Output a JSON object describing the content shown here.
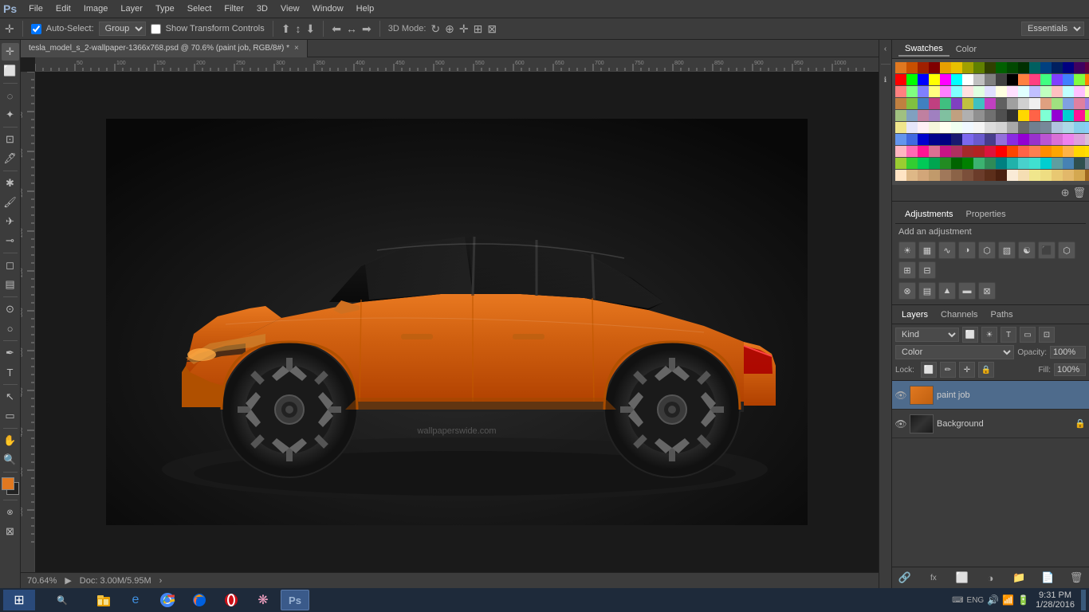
{
  "app": {
    "logo": "Ps",
    "title": "tesla_model_s_2-wallpaper-1366x768.psd @ 70.6% (paint job, RGB/8#) *"
  },
  "menubar": {
    "items": [
      "File",
      "Edit",
      "Image",
      "Layer",
      "Type",
      "Select",
      "Filter",
      "3D",
      "View",
      "Window",
      "Help"
    ]
  },
  "options_bar": {
    "auto_select_label": "Auto-Select:",
    "auto_select_type": "Group",
    "show_transform": "Show Transform Controls",
    "workspace": "Essentials"
  },
  "tab": {
    "filename": "tesla_model_s_2-wallpaper-1366x768.psd @ 70.6% (paint job, RGB/8#) *",
    "close": "×"
  },
  "swatches": {
    "title": "Swatches",
    "color_tab": "Color",
    "rows": [
      [
        "#e07820",
        "#c85000",
        "#a02000",
        "#800000",
        "#e8a000",
        "#e8c000",
        "#a0a000",
        "#608000",
        "#304000",
        "#006000",
        "#004800",
        "#003000",
        "#006060",
        "#004080",
        "#002060",
        "#000080",
        "#400060",
        "#600040",
        "#c00060",
        "#e00040"
      ],
      [
        "#ff0000",
        "#00ff00",
        "#0000ff",
        "#ffff00",
        "#ff00ff",
        "#00ffff",
        "#ffffff",
        "#c0c0c0",
        "#808080",
        "#404040",
        "#000000",
        "#ff8040",
        "#ff4080",
        "#40ff80",
        "#8040ff",
        "#4080ff",
        "#80ff40",
        "#ff8000",
        "#00ff80",
        "#8000ff"
      ],
      [
        "#ff8080",
        "#80ff80",
        "#8080ff",
        "#ffff80",
        "#ff80ff",
        "#80ffff",
        "#ffe0e0",
        "#e0ffe0",
        "#e0e0ff",
        "#ffffe0",
        "#ffe0ff",
        "#e0ffff",
        "#c0c0ff",
        "#c0ffc0",
        "#ffc0c0",
        "#c0ffff",
        "#ffc0ff",
        "#ffffc0",
        "#e08080",
        "#80e080"
      ],
      [
        "#c08040",
        "#80c040",
        "#4080c0",
        "#c04080",
        "#40c080",
        "#8040c0",
        "#c0c040",
        "#40c0c0",
        "#c040c0",
        "#606060",
        "#a0a0a0",
        "#d0d0d0",
        "#f0f0f0",
        "#e0a080",
        "#a0e080",
        "#80a0e0",
        "#e080a0",
        "#a080e0",
        "#80e0a0",
        "#e0c0a0"
      ],
      [
        "#a0c080",
        "#80a0c0",
        "#c080a0",
        "#a080c0",
        "#80c0a0",
        "#c0a080",
        "#b0b0b0",
        "#909090",
        "#707070",
        "#505050",
        "#303030",
        "#ffd700",
        "#ff6347",
        "#7fffd4",
        "#9400d3",
        "#00ced1",
        "#ff1493",
        "#00bfff",
        "#ffa500",
        "#adff2f"
      ],
      [
        "#f0e68c",
        "#e6e6fa",
        "#fff0f5",
        "#f5f5dc",
        "#fffff0",
        "#f0fff0",
        "#f0f8ff",
        "#f5f5f5",
        "#dcdcdc",
        "#d3d3d3",
        "#a9a9a9",
        "#696969",
        "#708090",
        "#778899",
        "#b0c4de",
        "#add8e6",
        "#87ceeb",
        "#87cefa",
        "#00bfff",
        "#1e90ff"
      ],
      [
        "#6495ed",
        "#4169e1",
        "#0000cd",
        "#00008b",
        "#000080",
        "#191970",
        "#7b68ee",
        "#6a5acd",
        "#483d8b",
        "#9370db",
        "#8a2be2",
        "#9400d3",
        "#9932cc",
        "#ba55d3",
        "#da70d6",
        "#ee82ee",
        "#dda0dd",
        "#d8bfd8",
        "#e0b0ff",
        "#c0a0e0"
      ],
      [
        "#ffb6c1",
        "#ff69b4",
        "#ff1493",
        "#db7093",
        "#c71585",
        "#b03060",
        "#a52a2a",
        "#b22222",
        "#dc143c",
        "#ff0000",
        "#ff4500",
        "#ff6347",
        "#ff7f50",
        "#fd8c00",
        "#ffa500",
        "#ffb347",
        "#ffd700",
        "#ffdf00",
        "#f5e216",
        "#ffe135"
      ],
      [
        "#9acd32",
        "#32cd32",
        "#00c957",
        "#00a550",
        "#228b22",
        "#006400",
        "#008000",
        "#3cb371",
        "#2e8b57",
        "#008080",
        "#20b2aa",
        "#48d1cc",
        "#40e0d0",
        "#00ced1",
        "#5f9ea0",
        "#4682b4",
        "#2f4f4f",
        "#708090",
        "#b0c4de",
        "#d2e0ef"
      ],
      [
        "#ffe4c4",
        "#deb887",
        "#d2a679",
        "#c19a6b",
        "#a0785a",
        "#8b6347",
        "#7b4f3a",
        "#6b3c2a",
        "#5c2e1a",
        "#4a200f",
        "#faebd7",
        "#f5deb3",
        "#f0e68c",
        "#eedd82",
        "#e8c872",
        "#e2b86a",
        "#d4a850",
        "#c89040",
        "#b87830",
        "#a06820"
      ]
    ]
  },
  "adjustments": {
    "title": "Adjustments",
    "properties": "Properties",
    "label": "Add an adjustment"
  },
  "layers": {
    "title": "Layers",
    "channels": "Channels",
    "paths": "Paths",
    "kind_label": "Kind",
    "blend_mode": "Color",
    "opacity_label": "Opacity:",
    "opacity_value": "100%",
    "fill_label": "Fill:",
    "fill_value": "100%",
    "lock_label": "Lock:",
    "items": [
      {
        "name": "paint job",
        "type": "paint",
        "visible": true,
        "locked": false
      },
      {
        "name": "Background",
        "type": "background",
        "visible": true,
        "locked": true
      }
    ]
  },
  "status_bar": {
    "zoom": "70.64%",
    "doc_info": "Doc: 3.00M/5.95M"
  },
  "taskbar": {
    "time": "9:31 PM",
    "date": "1/28/2016",
    "apps": [
      {
        "name": "windows-start",
        "icon": "⊞"
      },
      {
        "name": "file-explorer",
        "icon": "📁"
      },
      {
        "name": "ie",
        "icon": "e"
      },
      {
        "name": "chrome",
        "icon": "⚪"
      },
      {
        "name": "firefox",
        "icon": "🦊"
      },
      {
        "name": "opera",
        "icon": "O"
      },
      {
        "name": "flower-app",
        "icon": "❋"
      },
      {
        "name": "photoshop",
        "icon": "Ps"
      }
    ]
  }
}
